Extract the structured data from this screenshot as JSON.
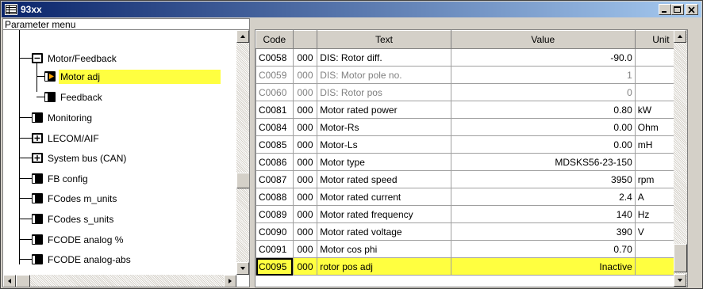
{
  "window": {
    "title": "93xx"
  },
  "titlebar_buttons": {
    "minimize": "_",
    "maximize": "□",
    "close": "×"
  },
  "left_panel": {
    "header": "Parameter menu",
    "tree": [
      {
        "label": "Motor/Feedback",
        "icon": "folder-expanded-icon"
      },
      {
        "label": "Motor adj",
        "icon": "page-arrow-icon",
        "selected": true
      },
      {
        "label": "Feedback",
        "icon": "page-icon"
      },
      {
        "label": "Monitoring",
        "icon": "page-icon"
      },
      {
        "label": "LECOM/AIF",
        "icon": "folder-collapsed-icon"
      },
      {
        "label": "System bus (CAN)",
        "icon": "folder-collapsed-icon"
      },
      {
        "label": "FB config",
        "icon": "page-icon"
      },
      {
        "label": "FCodes m_units",
        "icon": "page-icon"
      },
      {
        "label": "FCodes s_units",
        "icon": "page-icon"
      },
      {
        "label": "FCODE analog %",
        "icon": "page-icon"
      },
      {
        "label": "FCODE analog-abs",
        "icon": "page-icon"
      }
    ]
  },
  "table": {
    "columns": [
      "Code",
      "",
      "Text",
      "Value",
      "Unit"
    ],
    "rows": [
      {
        "code": "C0058",
        "sub": "000",
        "text": "DIS: Rotor diff.",
        "value": "-90.0",
        "unit": "",
        "state": "normal"
      },
      {
        "code": "C0059",
        "sub": "000",
        "text": "DIS: Motor pole no.",
        "value": "1",
        "unit": "",
        "state": "gray"
      },
      {
        "code": "C0060",
        "sub": "000",
        "text": "DIS: Rotor pos",
        "value": "0",
        "unit": "",
        "state": "gray"
      },
      {
        "code": "C0081",
        "sub": "000",
        "text": "Motor rated power",
        "value": "0.80",
        "unit": "kW",
        "state": "normal"
      },
      {
        "code": "C0084",
        "sub": "000",
        "text": "Motor-Rs",
        "value": "0.00",
        "unit": "Ohm",
        "state": "normal"
      },
      {
        "code": "C0085",
        "sub": "000",
        "text": "Motor-Ls",
        "value": "0.00",
        "unit": "mH",
        "state": "normal"
      },
      {
        "code": "C0086",
        "sub": "000",
        "text": "Motor type",
        "value": "MDSKS56-23-150",
        "unit": "",
        "state": "normal"
      },
      {
        "code": "C0087",
        "sub": "000",
        "text": "Motor rated speed",
        "value": "3950",
        "unit": "rpm",
        "state": "normal"
      },
      {
        "code": "C0088",
        "sub": "000",
        "text": "Motor rated current",
        "value": "2.4",
        "unit": "A",
        "state": "normal"
      },
      {
        "code": "C0089",
        "sub": "000",
        "text": "Motor rated frequency",
        "value": "140",
        "unit": "Hz",
        "state": "normal"
      },
      {
        "code": "C0090",
        "sub": "000",
        "text": "Motor rated voltage",
        "value": "390",
        "unit": "V",
        "state": "normal"
      },
      {
        "code": "C0091",
        "sub": "000",
        "text": "Motor cos phi",
        "value": "0.70",
        "unit": "",
        "state": "normal"
      },
      {
        "code": "C0095",
        "sub": "000",
        "text": "rotor pos adj",
        "value": "Inactive",
        "unit": "",
        "state": "highlight"
      }
    ]
  },
  "colors": {
    "titlebar_start": "#0a246a",
    "titlebar_end": "#a6caf0",
    "highlight": "#ffff40",
    "face": "#d4d0c8"
  }
}
